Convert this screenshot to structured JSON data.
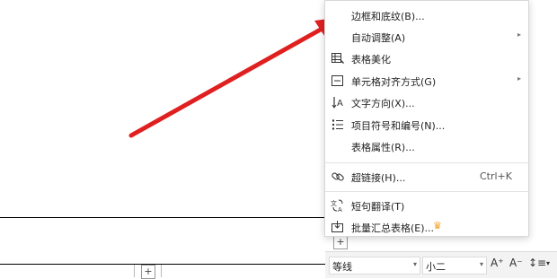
{
  "menu": {
    "items": [
      {
        "label": "边框和底纹(B)...",
        "icon": "none",
        "shortcut": "",
        "submenu": false
      },
      {
        "label": "自动调整(A)",
        "icon": "none",
        "shortcut": "",
        "submenu": true
      },
      {
        "label": "表格美化",
        "icon": "table-beautify-icon",
        "shortcut": "",
        "submenu": false
      },
      {
        "label": "单元格对齐方式(G)",
        "icon": "cell-align-icon",
        "shortcut": "",
        "submenu": true
      },
      {
        "label": "文字方向(X)...",
        "icon": "text-direction-icon",
        "shortcut": "",
        "submenu": false
      },
      {
        "label": "项目符号和编号(N)...",
        "icon": "bullet-list-icon",
        "shortcut": "",
        "submenu": false
      },
      {
        "label": "表格属性(R)...",
        "icon": "none",
        "shortcut": "",
        "submenu": false
      },
      {
        "label": "超链接(H)...",
        "icon": "link-icon",
        "shortcut": "Ctrl+K",
        "submenu": false
      },
      {
        "label": "短句翻译(T)",
        "icon": "translate-icon",
        "shortcut": "",
        "submenu": false
      },
      {
        "label": "批量汇总表格(E)...",
        "icon": "batch-summary-icon",
        "shortcut": "",
        "submenu": false
      }
    ],
    "submenu_glyph": "▸",
    "crown_glyph": "♛"
  },
  "toolbar": {
    "font_name": "等线",
    "font_size": "小二",
    "dropdown_glyph": "▾",
    "grow_font": "A⁺",
    "shrink_font": "A⁻",
    "line_spacing": "↕≡"
  },
  "document": {
    "plus_glyph": "+"
  },
  "colors": {
    "arrow": "#e02020",
    "crown": "#f0a020"
  }
}
